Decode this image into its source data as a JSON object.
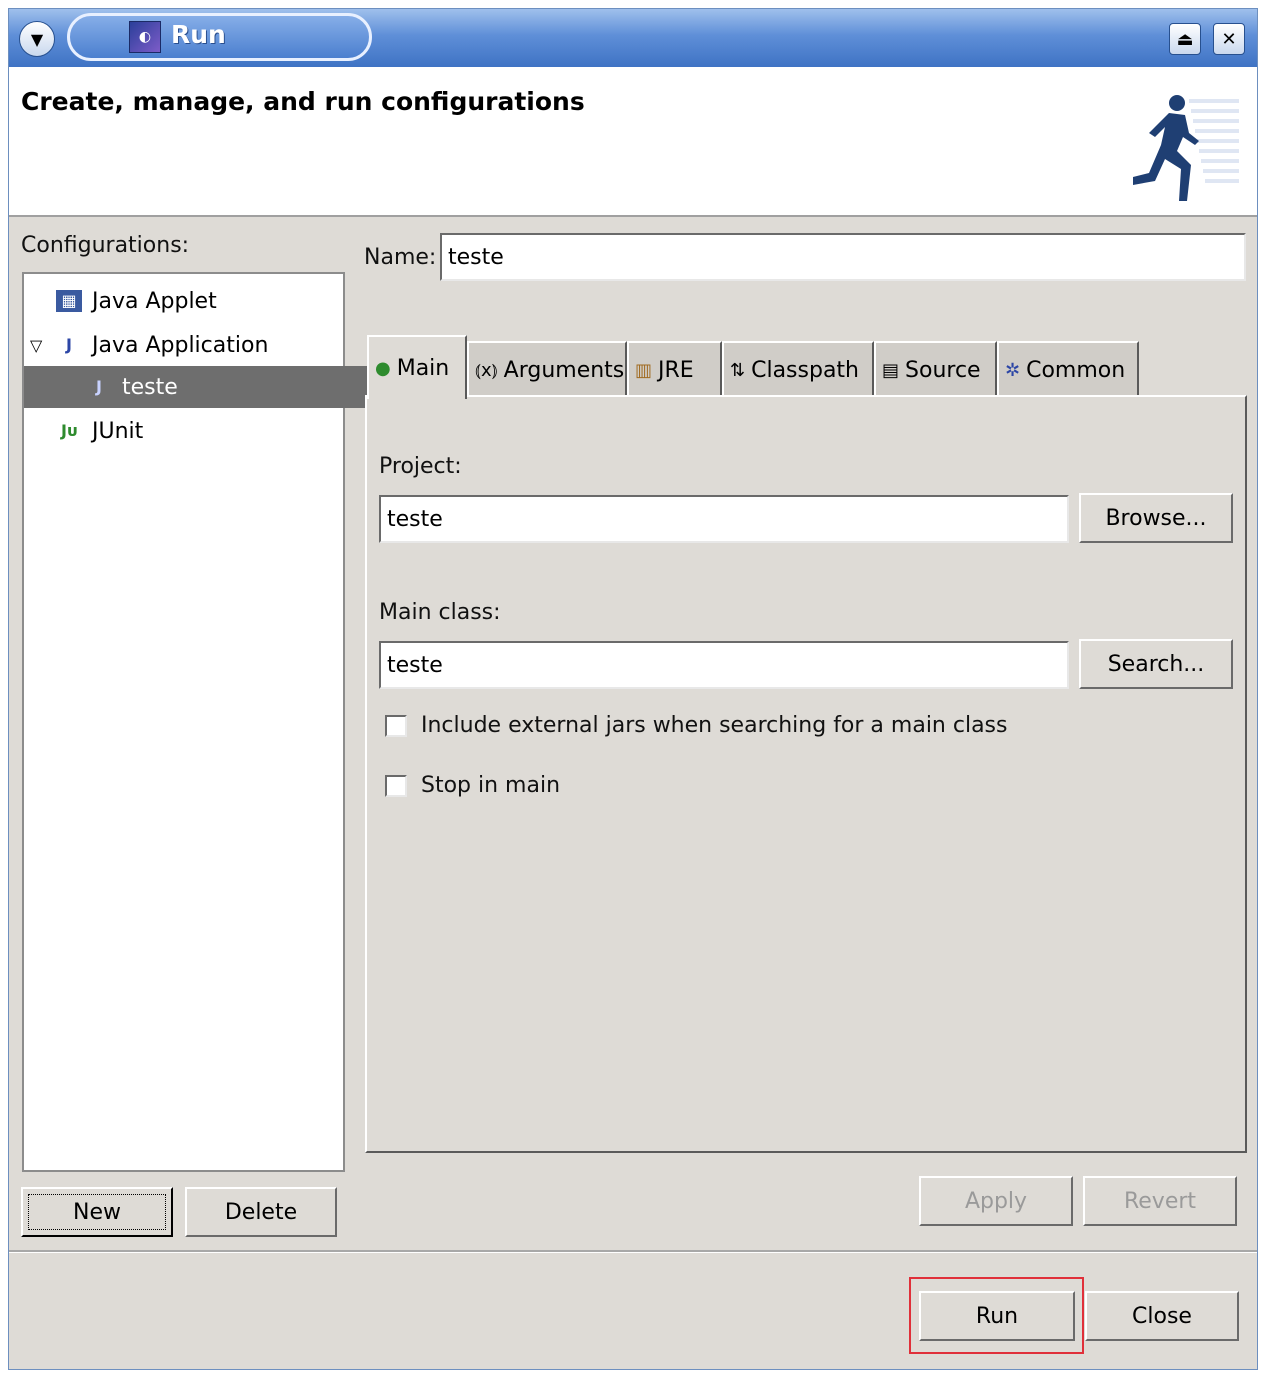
{
  "window": {
    "title": "Run"
  },
  "header": {
    "text": "Create, manage, and run configurations"
  },
  "left": {
    "configurations_label": "Configurations:",
    "tree": [
      {
        "label": "Java Applet",
        "icon": "java-applet-icon"
      },
      {
        "label": "Java Application",
        "icon": "java-application-icon",
        "expanded": true
      },
      {
        "label": "teste",
        "icon": "java-class-icon",
        "selected": true
      },
      {
        "label": "JUnit",
        "icon": "junit-icon"
      }
    ],
    "new_label": "New",
    "delete_label": "Delete"
  },
  "right": {
    "name_label": "Name:",
    "name_value": "teste",
    "tabs": [
      {
        "label": "Main",
        "icon": "main-tab-icon",
        "active": true
      },
      {
        "label": "Arguments",
        "icon": "arguments-tab-icon"
      },
      {
        "label": "JRE",
        "icon": "jre-tab-icon"
      },
      {
        "label": "Classpath",
        "icon": "classpath-tab-icon"
      },
      {
        "label": "Source",
        "icon": "source-tab-icon"
      },
      {
        "label": "Common",
        "icon": "common-tab-icon"
      }
    ],
    "project_label": "Project:",
    "project_value": "teste",
    "browse_label": "Browse...",
    "main_class_label": "Main class:",
    "main_class_value": "teste",
    "search_label": "Search...",
    "include_jars_label": "Include external jars when searching for a main class",
    "include_jars_checked": false,
    "stop_in_main_label": "Stop in main",
    "stop_in_main_checked": false,
    "apply_label": "Apply",
    "revert_label": "Revert"
  },
  "footer": {
    "run_label": "Run",
    "close_label": "Close"
  },
  "colors": {
    "titlebar": "#4b7fcf",
    "selection": "#6e6e6e",
    "highlight_box": "#e0303a"
  }
}
